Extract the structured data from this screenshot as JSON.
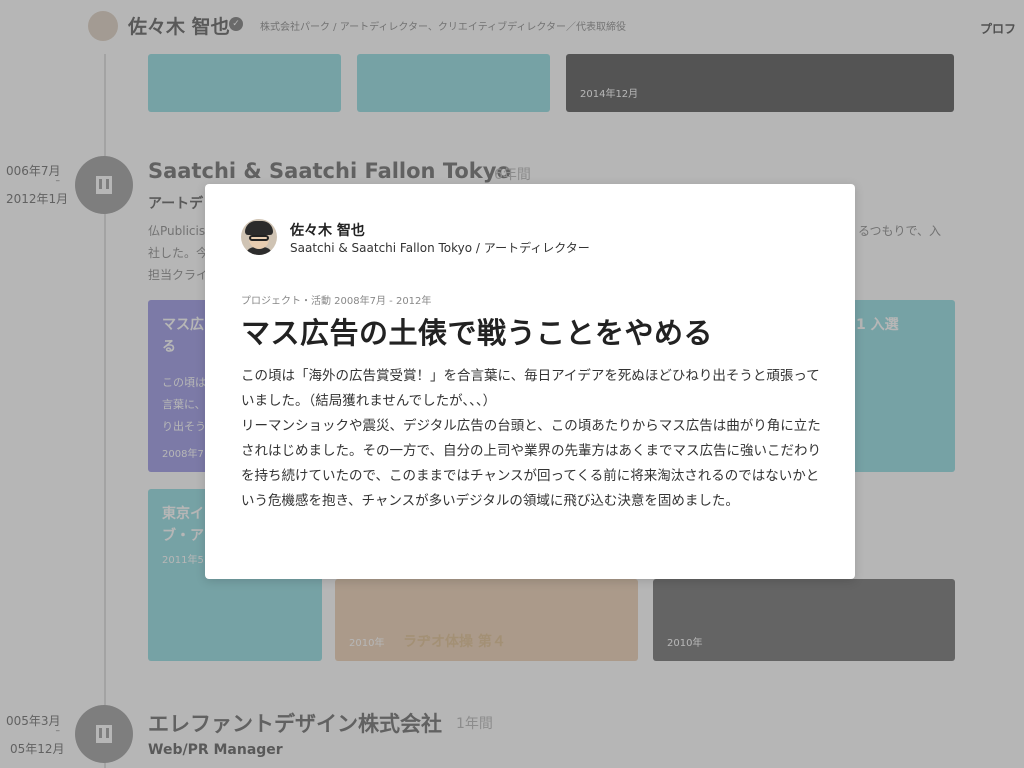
{
  "header": {
    "name": "佐々木 智也",
    "tagline": "株式会社パーク / アートディレクター、クリエイティブディレクター／代表取締役",
    "profile_link": "プロフ"
  },
  "top_cards": {
    "card3_date": "2014年12月"
  },
  "org1": {
    "period_start": "006年7月",
    "period_dash": "–",
    "period_end": "2012年1月",
    "name": "Saatchi & Saatchi Fallon Tokyo",
    "duration": "6年間",
    "role": "アートデ",
    "desc_line1": "仏Publicis",
    "desc_line1_right": "るつもりで、入",
    "desc_line2": "社した。今",
    "desc_line3": "担当クライ",
    "card1_title": "マス広",
    "card1_title2": "る",
    "card1_date": "2008年7",
    "card1_body1": "この頃は",
    "card1_body2": "言葉に、",
    "card1_body3": "り出そう",
    "card2_title": "1 入選",
    "card4_title": "東京イ",
    "card4_title2": "ブ・ア",
    "card4_date": "2011年5",
    "card5_date": "2010年",
    "card5_caption": "ラヂオ体操 第４",
    "card6_date": "2010年"
  },
  "org2": {
    "period_start": "005年3月",
    "period_dash": "–",
    "period_end": "05年12月",
    "name": "エレファントデザイン株式会社",
    "duration": "1年間",
    "role": "Web/PR Manager"
  },
  "modal": {
    "author_name": "佐々木 智也",
    "author_position": "Saatchi & Saatchi Fallon Tokyo / アートディレクター",
    "category": "プロジェクト・活動 2008年7月 - 2012年",
    "title": "マス広告の土俵で戦うことをやめる",
    "paragraph1": "この頃は「海外の広告賞受賞！」を合言葉に、毎日アイデアを死ぬほどひねり出そうと頑張っていました。（結局獲れませんでしたが、、、）",
    "paragraph2": "リーマンショックや震災、デジタル広告の台頭と、この頃あたりからマス広告は曲がり角に立たされはじめました。その一方で、自分の上司や業界の先輩方はあくまでマス広告に強いこだわりを持ち続けていたので、このままではチャンスが回ってくる前に将来淘汰されるのではないかという危機感を抱き、チャンスが多いデジタルの領域に飛び込む決意を固めました。"
  },
  "colors": {
    "overlay": "#6e6e6e",
    "card_teal": "#7fd6dc",
    "card_purple": "#8a87e0"
  }
}
